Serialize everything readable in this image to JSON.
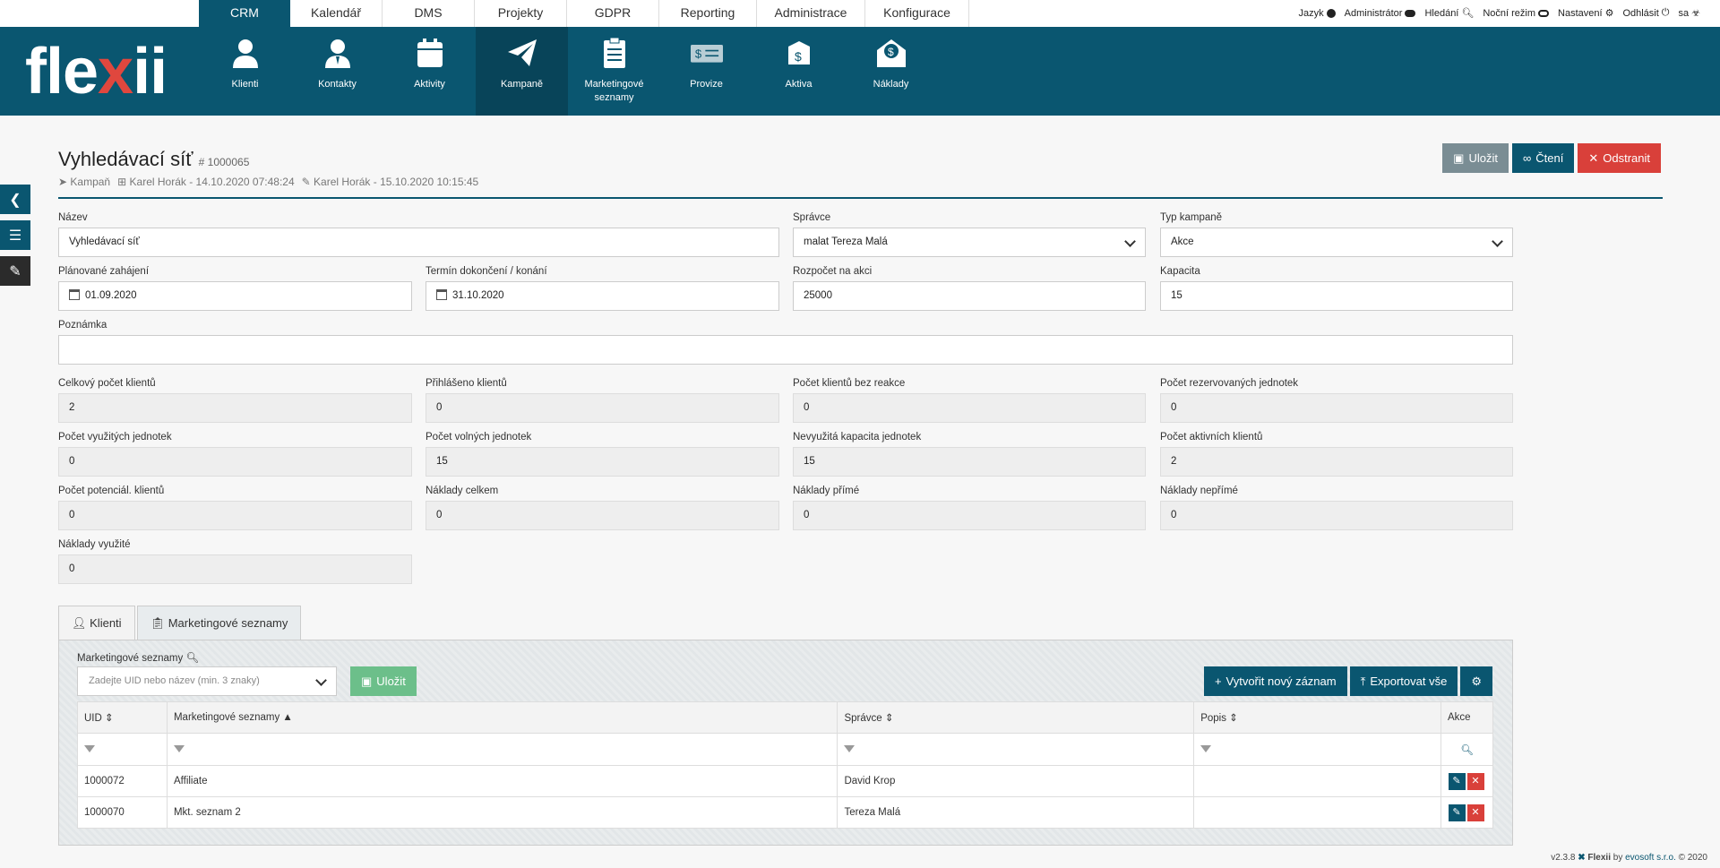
{
  "top_tabs": [
    "CRM",
    "Kalendář",
    "DMS",
    "Projekty",
    "GDPR",
    "Reporting",
    "Administrace",
    "Konfigurace"
  ],
  "top_right": {
    "jazyk": "Jazyk",
    "admin": "Administrátor",
    "hledani": "Hledání",
    "nocni": "Noční režim",
    "nastaveni": "Nastavení",
    "odhlasit": "Odhlásit",
    "user": "sa"
  },
  "logo": {
    "a": "fle",
    "x": "x",
    "b": "ii"
  },
  "nav": [
    "Klienti",
    "Kontakty",
    "Aktivity",
    "Kampaně",
    "Marketingové seznamy",
    "Provize",
    "Aktiva",
    "Náklady"
  ],
  "header": {
    "title": "Vyhledávací síť",
    "id": "# 1000065",
    "type": "Kampaň",
    "created": "Karel Horák - 14.10.2020 07:48:24",
    "modified": "Karel Horák - 15.10.2020 10:15:45",
    "save": "Uložit",
    "read": "Čtení",
    "delete": "Odstranit"
  },
  "form": {
    "nazev_l": "Název",
    "nazev": "Vyhledávací síť",
    "spravce_l": "Správce",
    "spravce": "malat  Tereza Malá",
    "typ_l": "Typ kampaně",
    "typ": "Akce",
    "zah_l": "Plánované zahájení",
    "zah": "01.09.2020",
    "term_l": "Termín dokončení / konání",
    "term": "31.10.2020",
    "rozp_l": "Rozpočet na akci",
    "rozp": "25000",
    "kap_l": "Kapacita",
    "kap": "15",
    "pozn_l": "Poznámka",
    "pozn": "",
    "r1": [
      [
        "Celkový počet klientů",
        "2"
      ],
      [
        "Přihlášeno klientů",
        "0"
      ],
      [
        "Počet klientů bez reakce",
        "0"
      ],
      [
        "Počet rezervovaných jednotek",
        "0"
      ]
    ],
    "r2": [
      [
        "Počet využitých jednotek",
        "0"
      ],
      [
        "Počet volných jednotek",
        "15"
      ],
      [
        "Nevyužitá kapacita jednotek",
        "15"
      ],
      [
        "Počet aktivních klientů",
        "2"
      ]
    ],
    "r3": [
      [
        "Počet potenciál. klientů",
        "0"
      ],
      [
        "Náklady celkem",
        "0"
      ],
      [
        "Náklady přímé",
        "0"
      ],
      [
        "Náklady nepřímé",
        "0"
      ]
    ],
    "r4": [
      [
        "Náklady využité",
        "0"
      ]
    ]
  },
  "tabs": [
    "Klienti",
    "Marketingové seznamy"
  ],
  "ml": {
    "label": "Marketingové seznamy",
    "placeholder": "Zadejte UID nebo název (min. 3 znaky)",
    "save": "Uložit",
    "create": "Vytvořit nový záznam",
    "export": "Exportovat vše"
  },
  "table": {
    "headers": [
      "UID",
      "Marketingové seznamy",
      "Správce",
      "Popis",
      "Akce"
    ],
    "rows": [
      [
        "1000072",
        "Affiliate",
        "David Krop",
        ""
      ],
      [
        "1000070",
        "Mkt. seznam 2",
        "Tereza Malá",
        ""
      ]
    ]
  },
  "version": {
    "v": "v2.3.8",
    "app": "Flexii",
    "by": "by",
    "company": "evosoft s.r.o.",
    "year": "© 2020"
  }
}
